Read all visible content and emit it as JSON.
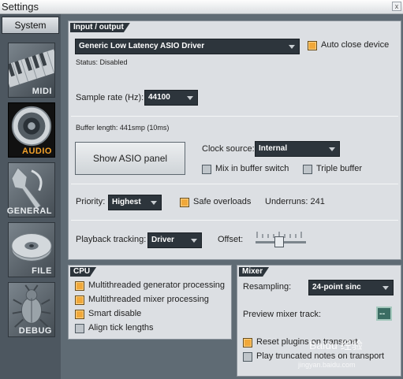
{
  "window": {
    "title": "Settings",
    "close_glyph": "x"
  },
  "sidebar": {
    "system_label": "System",
    "items": [
      {
        "label": "MIDI",
        "icon": "piano-keys-icon"
      },
      {
        "label": "AUDIO",
        "icon": "speaker-icon",
        "active": true
      },
      {
        "label": "GENERAL",
        "icon": "wrench-icon"
      },
      {
        "label": "FILE",
        "icon": "disc-icon"
      },
      {
        "label": "DEBUG",
        "icon": "bug-icon"
      }
    ]
  },
  "io": {
    "header": "Input / output",
    "driver": "Generic Low Latency ASIO Driver",
    "auto_close_label": "Auto close device",
    "auto_close_checked": true,
    "status": "Status:  Disabled",
    "sample_rate_label": "Sample rate (Hz):",
    "sample_rate_value": "44100",
    "buffer_length": "Buffer length: 441smp (10ms)",
    "show_asio_label": "Show ASIO panel",
    "clock_source_label": "Clock source:",
    "clock_source_value": "Internal",
    "mix_in_buffer_label": "Mix in buffer switch",
    "mix_in_buffer_checked": false,
    "triple_buffer_label": "Triple buffer",
    "triple_buffer_checked": false,
    "priority_label": "Priority:",
    "priority_value": "Highest",
    "safe_overloads_label": "Safe overloads",
    "safe_overloads_checked": true,
    "underruns": "Underruns: 241",
    "playback_tracking_label": "Playback tracking:",
    "playback_tracking_value": "Driver",
    "offset_label": "Offset:"
  },
  "cpu": {
    "header": "CPU",
    "options": [
      {
        "label": "Multithreaded generator processing",
        "checked": true
      },
      {
        "label": "Multithreaded mixer processing",
        "checked": true
      },
      {
        "label": "Smart disable",
        "checked": true
      },
      {
        "label": "Align tick lengths",
        "checked": false
      }
    ]
  },
  "mixer": {
    "header": "Mixer",
    "resampling_label": "Resampling:",
    "resampling_value": "24-point sinc",
    "preview_track_label": "Preview mixer track:",
    "preview_track_value": "--",
    "reset_plugins_label": "Reset plugins on transport",
    "reset_plugins_checked": true,
    "play_truncated_label": "Play truncated notes on transport",
    "play_truncated_checked": false
  },
  "watermark": {
    "main": "Baidu 经验",
    "sub": "jingyan.baidu.com"
  },
  "colors": {
    "accent": "#f0a83a",
    "panel_bg": "#dcdfe3",
    "dropdown_bg": "#2d353c",
    "frame_bg": "#5f6b74"
  }
}
